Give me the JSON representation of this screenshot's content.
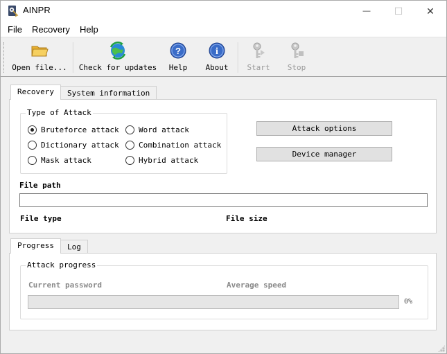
{
  "window": {
    "title": "AINPR",
    "minimize_glyph": "—",
    "maximize_glyph": "☐",
    "close_glyph": "✕"
  },
  "menu": {
    "items": [
      {
        "label": "File"
      },
      {
        "label": "Recovery"
      },
      {
        "label": "Help"
      }
    ]
  },
  "toolbar": {
    "open_file": {
      "label": "Open file...",
      "icon": "folder-icon"
    },
    "check_updates": {
      "label": "Check for updates",
      "icon": "globe-refresh-icon"
    },
    "help": {
      "label": "Help",
      "icon": "help-icon"
    },
    "about": {
      "label": "About",
      "icon": "info-icon"
    },
    "start": {
      "label": "Start",
      "icon": "key-icon",
      "disabled": true
    },
    "stop": {
      "label": "Stop",
      "icon": "key-stop-icon",
      "disabled": true
    }
  },
  "top_tabs": {
    "recovery": "Recovery",
    "system_information": "System information",
    "active": "recovery"
  },
  "attack": {
    "group_title": "Type of Attack",
    "options": [
      {
        "label": "Bruteforce attack",
        "selected": true
      },
      {
        "label": "Word attack",
        "selected": false
      },
      {
        "label": "Dictionary attack",
        "selected": false
      },
      {
        "label": "Combination attack",
        "selected": false
      },
      {
        "label": "Mask attack",
        "selected": false
      },
      {
        "label": "Hybrid attack",
        "selected": false
      }
    ],
    "attack_options_button": "Attack options",
    "device_manager_button": "Device manager"
  },
  "file": {
    "path_label": "File path",
    "path_value": "",
    "type_label": "File type",
    "size_label": "File size"
  },
  "bottom_tabs": {
    "progress": "Progress",
    "log": "Log",
    "active": "progress"
  },
  "progress": {
    "group_title": "Attack progress",
    "current_password_label": "Current password",
    "average_speed_label": "Average speed",
    "percent": 0,
    "percent_text": "0%"
  },
  "colors": {
    "window_bg": "#f0f0f0",
    "panel_bg": "#ffffff",
    "button_bg": "#e1e1e1",
    "help_icon_blue": "#2f5fb8",
    "folder_yellow": "#f0c040"
  }
}
